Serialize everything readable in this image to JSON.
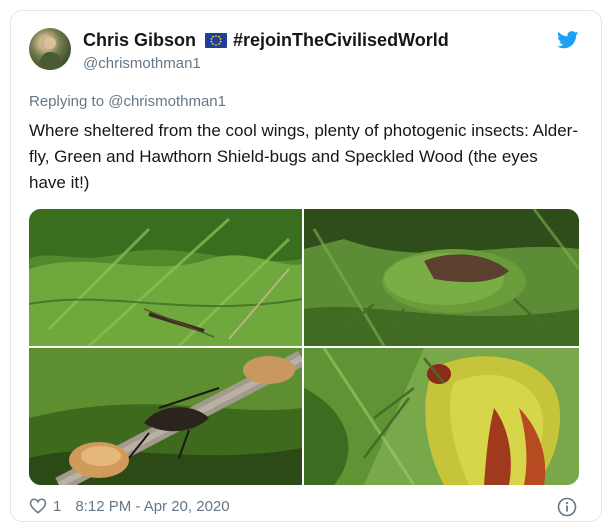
{
  "tweet": {
    "display_name": "Chris Gibson",
    "hashtag": "#rejoinTheCivilisedWorld",
    "handle": "@chrismothman1",
    "replying_prefix": "Replying to",
    "replying_to": "@chrismothman1",
    "text": "Where sheltered from the cool wings, plenty of photogenic insects: Alder-fly, Green and Hawthorn Shield-bugs and Speckled Wood (the eyes have it!)",
    "likes": "1",
    "timestamp": "8:12 PM - Apr 20, 2020"
  },
  "icons": {
    "platform": "twitter-bird-icon",
    "flag": "eu-flag-icon",
    "like": "heart-icon",
    "info": "info-icon"
  },
  "colors": {
    "twitter_blue": "#1da1f2",
    "text": "#14171a",
    "secondary_text": "#657786",
    "border": "#e1e8ed"
  }
}
